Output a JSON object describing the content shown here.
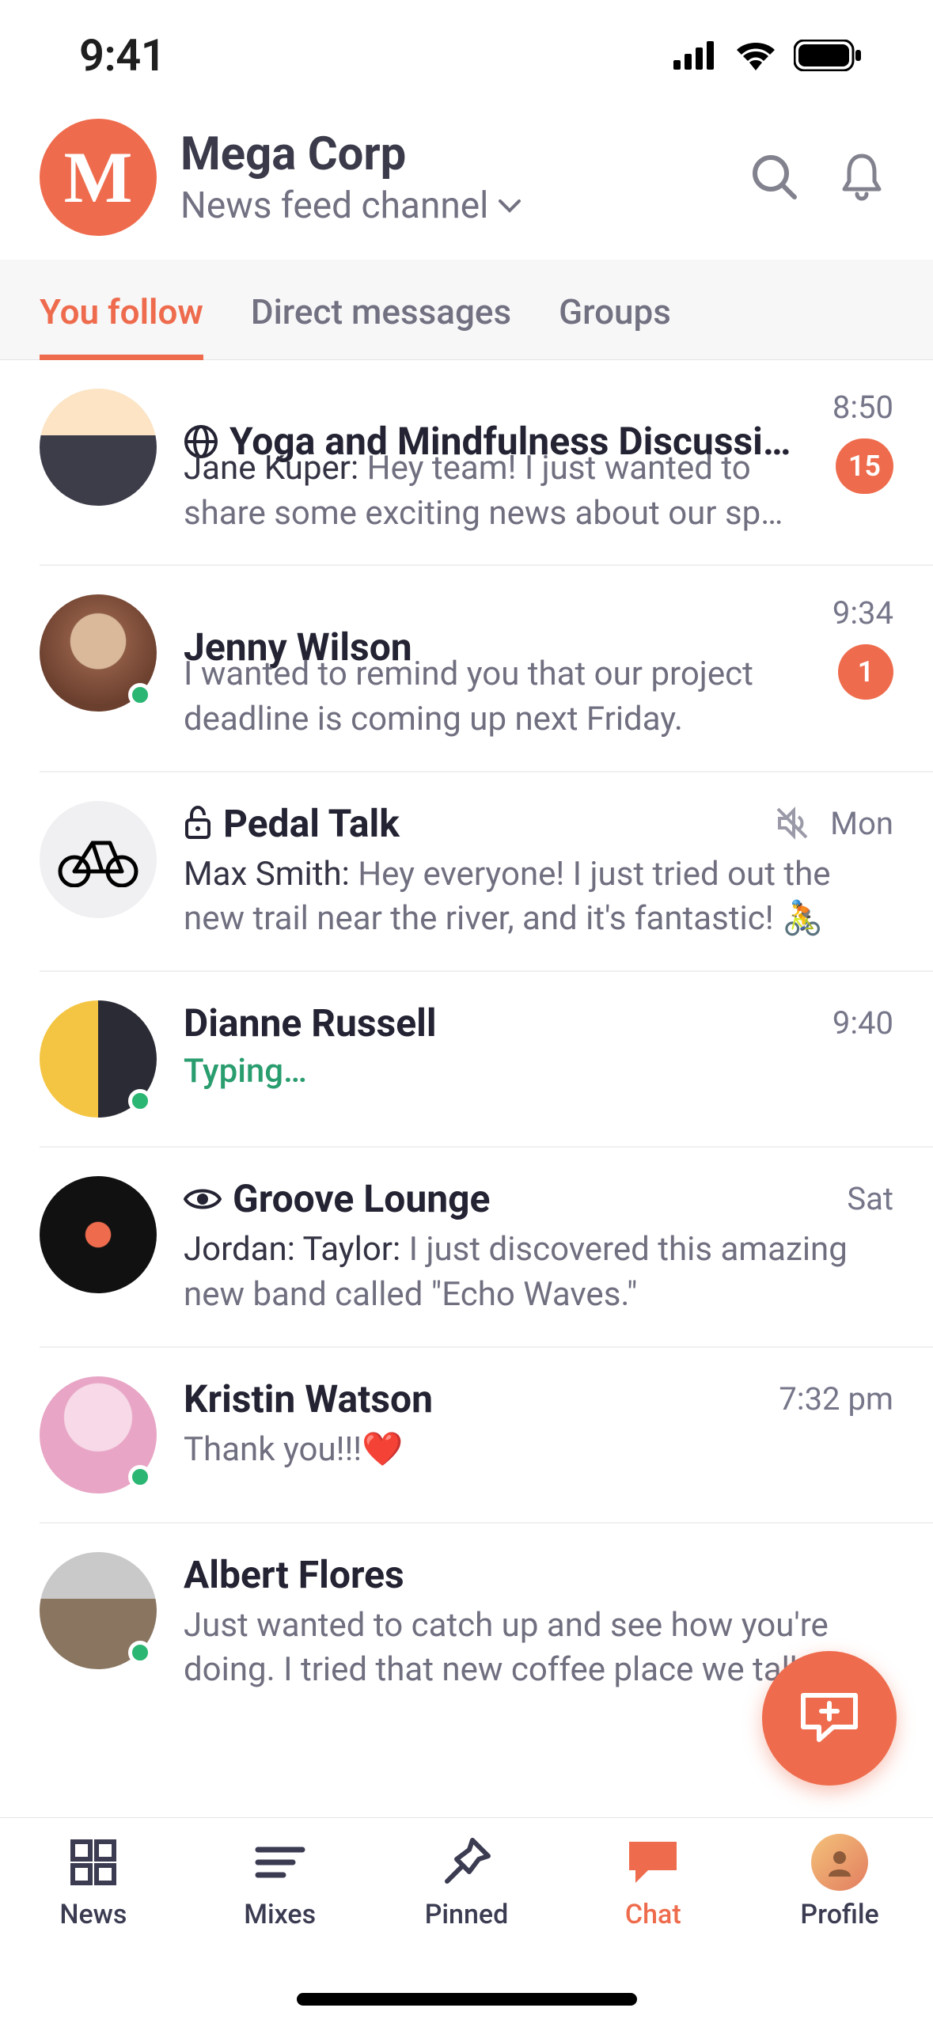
{
  "status": {
    "time": "9:41"
  },
  "header": {
    "logo_letter": "M",
    "title": "Mega Corp",
    "subtitle": "News feed channel"
  },
  "tabs": {
    "items": [
      {
        "label": "You follow",
        "active": true
      },
      {
        "label": "Direct messages",
        "active": false
      },
      {
        "label": "Groups",
        "active": false
      }
    ]
  },
  "chats": [
    {
      "icon_type": "globe",
      "title": "Yoga and Mindfulness Discussi…",
      "time": "8:50",
      "sender": "Jane Kuper:",
      "message": "Hey team! I just wanted to share some exciting news about our sp…",
      "badge": "15",
      "online": false
    },
    {
      "icon_type": null,
      "title": "Jenny Wilson",
      "time": "9:34",
      "sender": "",
      "message": "I wanted to remind you that our project deadline is coming up next Friday.",
      "badge": "1",
      "online": true
    },
    {
      "icon_type": "lock",
      "title": "Pedal Talk",
      "time": "Mon",
      "sender": "Max Smith:",
      "message": "Hey everyone! I just tried out the new trail near the river, and it's fantastic! 🚴",
      "muted": true,
      "online": false
    },
    {
      "icon_type": null,
      "title": "Dianne Russell",
      "time": "9:40",
      "typing": "Typing…",
      "online": true
    },
    {
      "icon_type": "eye",
      "title": "Groove Lounge",
      "time": "Sat",
      "sender": "Jordan: Taylor:",
      "message": "I just discovered this amazing  new band called \"Echo Waves.\"",
      "online": false
    },
    {
      "icon_type": null,
      "title": "Kristin Watson",
      "time": "7:32 pm",
      "sender": "",
      "message": "Thank you!!!❤️",
      "online": true
    },
    {
      "icon_type": null,
      "title": "Albert Flores",
      "time": "",
      "sender": "",
      "message": "Just wanted to catch up and see how you're doing. I tried that new coffee place we talked",
      "online": true
    }
  ],
  "bottom_nav": {
    "items": [
      {
        "label": "News"
      },
      {
        "label": "Mixes"
      },
      {
        "label": "Pinned"
      },
      {
        "label": "Chat"
      },
      {
        "label": "Profile"
      }
    ]
  }
}
